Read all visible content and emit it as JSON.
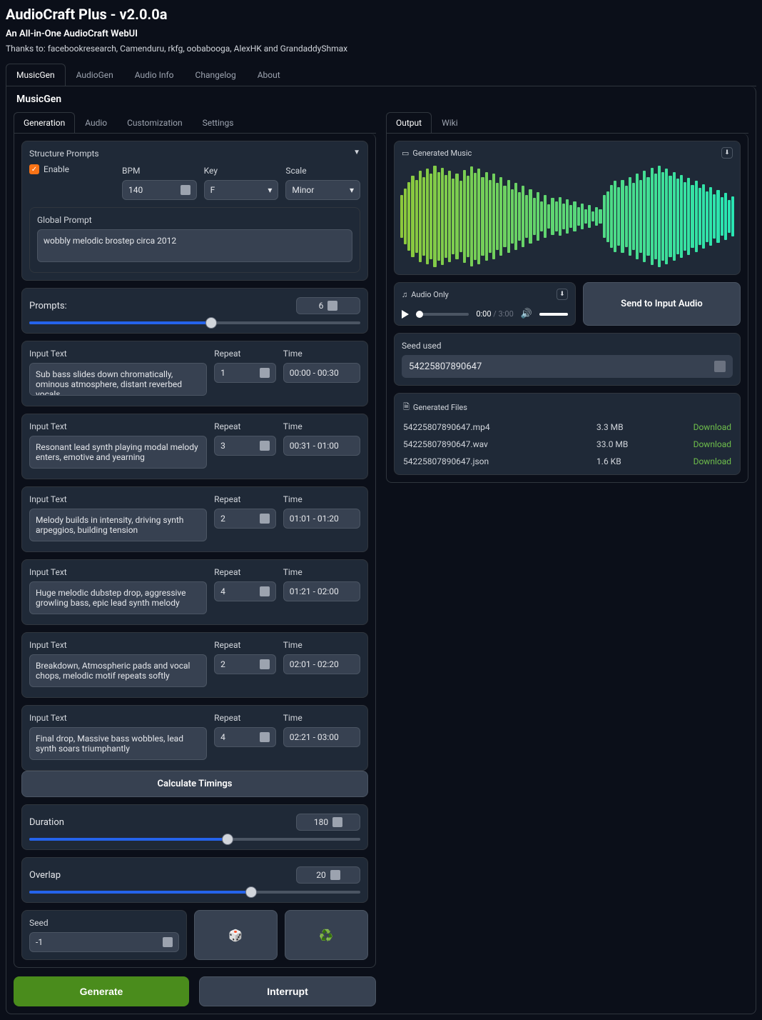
{
  "header": {
    "title": "AudioCraft Plus - v2.0.0a",
    "subtitle": "An All-in-One AudioCraft WebUI",
    "thanks": "Thanks to: facebookresearch, Camenduru, rkfg, oobabooga, AlexHK and GrandaddyShmax"
  },
  "main_tabs": [
    "MusicGen",
    "AudioGen",
    "Audio Info",
    "Changelog",
    "About"
  ],
  "panel_title": "MusicGen",
  "left_tabs": [
    "Generation",
    "Audio",
    "Customization",
    "Settings"
  ],
  "structure": {
    "title": "Structure Prompts",
    "enable_label": "Enable",
    "bpm_label": "BPM",
    "bpm_value": "140",
    "key_label": "Key",
    "key_value": "F",
    "scale_label": "Scale",
    "scale_value": "Minor",
    "global_prompt_label": "Global Prompt",
    "global_prompt_value": "wobbly melodic brostep circa 2012"
  },
  "prompts_slider": {
    "label": "Prompts:",
    "value": "6"
  },
  "prompt_rows": [
    {
      "text_label": "Input Text",
      "text": "Sub bass slides down chromatically, ominous atmosphere, distant reverbed vocals",
      "repeat_label": "Repeat",
      "repeat": "1",
      "time_label": "Time",
      "time": "00:00 - 00:30"
    },
    {
      "text_label": "Input Text",
      "text": "Resonant lead synth playing modal melody enters, emotive and yearning",
      "repeat_label": "Repeat",
      "repeat": "3",
      "time_label": "Time",
      "time": "00:31 - 01:00"
    },
    {
      "text_label": "Input Text",
      "text": "Melody builds in intensity, driving synth arpeggios, building tension",
      "repeat_label": "Repeat",
      "repeat": "2",
      "time_label": "Time",
      "time": "01:01 - 01:20"
    },
    {
      "text_label": "Input Text",
      "text": "Huge melodic dubstep drop, aggressive growling bass, epic lead synth melody",
      "repeat_label": "Repeat",
      "repeat": "4",
      "time_label": "Time",
      "time": "01:21 - 02:00"
    },
    {
      "text_label": "Input Text",
      "text": "Breakdown, Atmospheric pads and vocal chops, melodic motif repeats softly",
      "repeat_label": "Repeat",
      "repeat": "2",
      "time_label": "Time",
      "time": "02:01 - 02:20"
    },
    {
      "text_label": "Input Text",
      "text": "Final drop, Massive bass wobbles, lead synth soars triumphantly",
      "repeat_label": "Repeat",
      "repeat": "4",
      "time_label": "Time",
      "time": "02:21 - 03:00"
    }
  ],
  "calc_timings": "Calculate Timings",
  "duration": {
    "label": "Duration",
    "value": "180"
  },
  "overlap": {
    "label": "Overlap",
    "value": "20"
  },
  "seed": {
    "label": "Seed",
    "value": "-1"
  },
  "generate": "Generate",
  "interrupt": "Interrupt",
  "right_tabs": [
    "Output",
    "Wiki"
  ],
  "generated_music_label": "Generated Music",
  "audio_only_label": "Audio Only",
  "audio_time_current": "0:00",
  "audio_time_total": "3:00",
  "send_to_input": "Send to Input Audio",
  "seed_used_label": "Seed used",
  "seed_used_value": "54225807890647",
  "generated_files_label": "Generated Files",
  "files": [
    {
      "name": "54225807890647.mp4",
      "size": "3.3 MB",
      "dl": "Download"
    },
    {
      "name": "54225807890647.wav",
      "size": "33.0 MB",
      "dl": "Download"
    },
    {
      "name": "54225807890647.json",
      "size": "1.6 KB",
      "dl": "Download"
    }
  ],
  "waveform_heights": [
    42,
    55,
    68,
    80,
    72,
    90,
    78,
    95,
    85,
    100,
    88,
    96,
    82,
    90,
    75,
    85,
    70,
    92,
    80,
    98,
    86,
    94,
    78,
    88,
    72,
    84,
    66,
    78,
    60,
    72,
    54,
    66,
    48,
    60,
    42,
    54,
    36,
    48,
    30,
    42,
    24,
    36,
    30,
    38,
    26,
    34,
    22,
    30,
    18,
    26,
    14,
    22,
    10,
    18,
    14,
    42,
    50,
    62,
    70,
    58,
    72,
    60,
    78,
    66,
    84,
    72,
    90,
    78,
    96,
    84,
    100,
    88,
    94,
    80,
    88,
    74,
    82,
    68,
    76,
    62,
    70,
    56,
    64,
    50,
    58,
    44,
    52,
    38,
    46,
    32,
    40
  ]
}
